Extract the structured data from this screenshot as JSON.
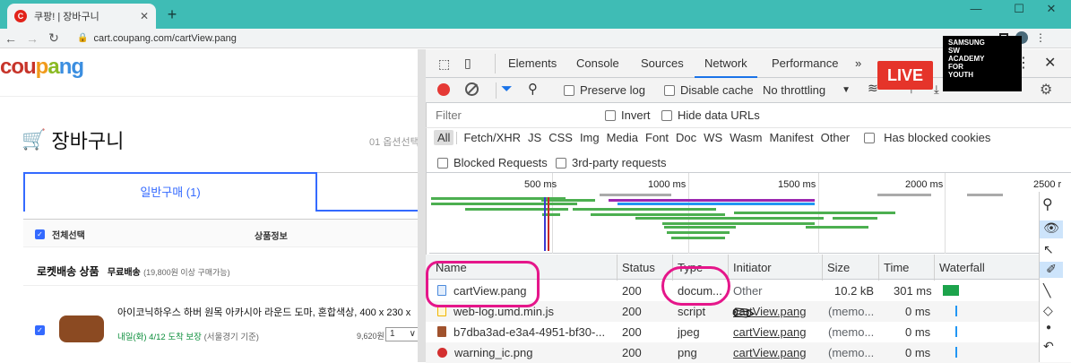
{
  "browser": {
    "tab_title": "쿠팡! | 장바구니",
    "favicon_letter": "C",
    "new_tab": "+",
    "url": "cart.coupang.com/cartView.pang"
  },
  "page": {
    "logo": [
      "cou",
      "p",
      "a",
      "ng"
    ],
    "cart_title": "장바구니",
    "step": "01 옵션선택",
    "tab_general": "일반구매 (1)",
    "select_all": "전체선택",
    "product_info": "상품정보",
    "rocket_label": "로켓배송 상품",
    "free_shipping": "무료배송",
    "free_note": "(19,800원 이상 구매가능)",
    "item_name": "아이코닉하우스 하버 원목 아카시아 라운드 도마, 혼합색상, 400 x 230 x",
    "delivery": "내일(화) 4/12 도착 보장",
    "delivery_note": "(서울경기 기준)",
    "price": "9,620원",
    "qty": "1"
  },
  "devtools": {
    "tabs": [
      "Elements",
      "Console",
      "Sources",
      "Network",
      "Performance",
      "»"
    ],
    "active_tab": "Network",
    "preserve_log": "Preserve log",
    "disable_cache": "Disable cache",
    "throttling": "No throttling",
    "filter_placeholder": "Filter",
    "invert": "Invert",
    "hide_data_urls": "Hide data URLs",
    "type_filters": [
      "All",
      "Fetch/XHR",
      "JS",
      "CSS",
      "Img",
      "Media",
      "Font",
      "Doc",
      "WS",
      "Wasm",
      "Manifest",
      "Other"
    ],
    "has_blocked_cookies": "Has blocked cookies",
    "blocked_requests": "Blocked Requests",
    "third_party": "3rd-party requests",
    "timeline_ticks": [
      "500 ms",
      "1000 ms",
      "1500 ms",
      "2000 ms",
      "2500 r"
    ],
    "columns": [
      "Name",
      "Status",
      "Type",
      "Initiator",
      "Size",
      "Time",
      "Waterfall"
    ],
    "rows": [
      {
        "name": "cartView.pang",
        "status": "200",
        "type": "docum...",
        "initiator": "Other",
        "size": "10.2 kB",
        "time": "301 ms",
        "icon_color": "#4a89dc"
      },
      {
        "name": "web-log.umd.min.js",
        "status": "200",
        "type": "script",
        "initiator": "cartView.pang",
        "size": "(memo...",
        "time": "0 ms",
        "icon_color": "#f0b400"
      },
      {
        "name": "b7dba3ad-e3a4-4951-bf30-...",
        "status": "200",
        "type": "jpeg",
        "initiator": "cartView.pang",
        "size": "(memo...",
        "time": "0 ms",
        "icon_color": "#a0522d"
      },
      {
        "name": "warning_ic.png",
        "status": "200",
        "type": "png",
        "initiator": "cartView.pang",
        "size": "(memo...",
        "time": "0 ms",
        "icon_color": "#d32f2f"
      }
    ]
  },
  "overlay": {
    "live": "LIVE",
    "samsung_lines": [
      "SAMSUNG",
      "SW",
      "ACADEMY",
      "FOR",
      "YOUTH"
    ]
  }
}
